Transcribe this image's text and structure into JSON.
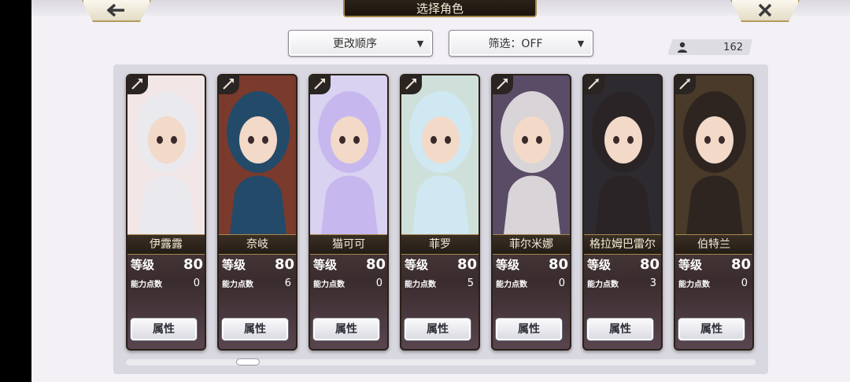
{
  "header": {
    "back_icon": "arrow-left-icon",
    "close_icon": "close-icon",
    "title": "选择角色"
  },
  "controls": {
    "sort_label": "更改顺序",
    "filter_label": "筛选：OFF",
    "caret_icon": "triangle-down-icon"
  },
  "owned": {
    "icon": "user-icon",
    "count": "162"
  },
  "cards": [
    {
      "name": "伊露露",
      "level_label": "等级",
      "level": "80",
      "ap_label": "能力点数",
      "ap": "0",
      "attr_label": "属性",
      "weapon": "axe-icon"
    },
    {
      "name": "奈岐",
      "level_label": "等级",
      "level": "80",
      "ap_label": "能力点数",
      "ap": "6",
      "attr_label": "属性",
      "weapon": "axe-icon"
    },
    {
      "name": "猫可可",
      "level_label": "等级",
      "level": "80",
      "ap_label": "能力点数",
      "ap": "0",
      "attr_label": "属性",
      "weapon": "axe-icon"
    },
    {
      "name": "菲罗",
      "level_label": "等级",
      "level": "80",
      "ap_label": "能力点数",
      "ap": "5",
      "attr_label": "属性",
      "weapon": "axe-icon"
    },
    {
      "name": "菲尔米娜",
      "level_label": "等级",
      "level": "80",
      "ap_label": "能力点数",
      "ap": "0",
      "attr_label": "属性",
      "weapon": "axe-icon"
    },
    {
      "name": "格拉姆巴雷尔",
      "level_label": "等级",
      "level": "80",
      "ap_label": "能力点数",
      "ap": "3",
      "attr_label": "属性",
      "weapon": "spear-icon"
    },
    {
      "name": "伯特兰",
      "level_label": "等级",
      "level": "80",
      "ap_label": "能力点数",
      "ap": "0",
      "attr_label": "属性",
      "weapon": "spear-icon"
    }
  ],
  "colors": {
    "accent_gold": "#a8874c",
    "banner_dark": "#1a140e",
    "card_art": [
      "#f3e6e6",
      "#7a3a2c",
      "#d9d2f0",
      "#cfe0da",
      "#5a4c66",
      "#2d2a30",
      "#4a3a2a"
    ],
    "card_hair": [
      "#e9e9ee",
      "#244a6a",
      "#c6b8ee",
      "#cfe8f2",
      "#d8d4d8",
      "#2a2426",
      "#2e2520"
    ]
  }
}
